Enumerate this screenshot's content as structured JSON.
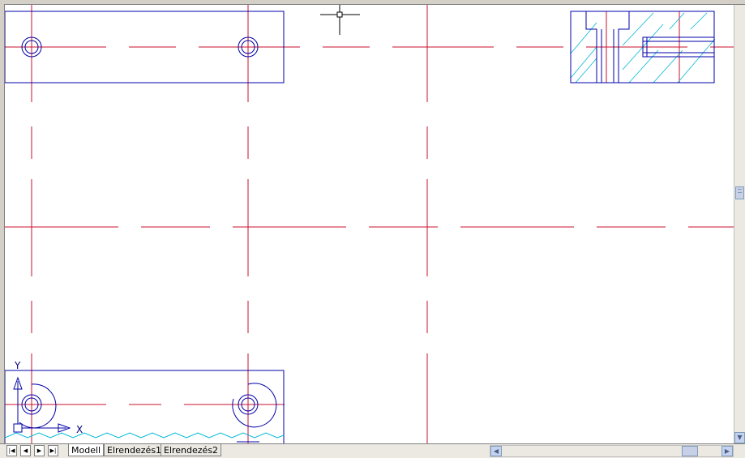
{
  "drawing": {
    "axis_x_label": "X",
    "axis_y_label": "Y",
    "colors": {
      "centerline": "#c8102e",
      "outline": "#0000a8",
      "hatch": "#00b8d8",
      "background": "#ffffff"
    }
  },
  "layout_tabs": [
    {
      "label": "Modell",
      "active": true
    },
    {
      "label": "Elrendezés1",
      "active": false
    },
    {
      "label": "Elrendezés2",
      "active": false
    }
  ],
  "tab_nav": {
    "first_icon": "first-page-icon",
    "prev_icon": "prev-icon",
    "next_icon": "next-icon",
    "last_icon": "last-page-icon"
  },
  "scroll": {
    "vertical_icon": "scroll-grip-icon",
    "horizontal_icon": "scroll-grip-icon"
  }
}
